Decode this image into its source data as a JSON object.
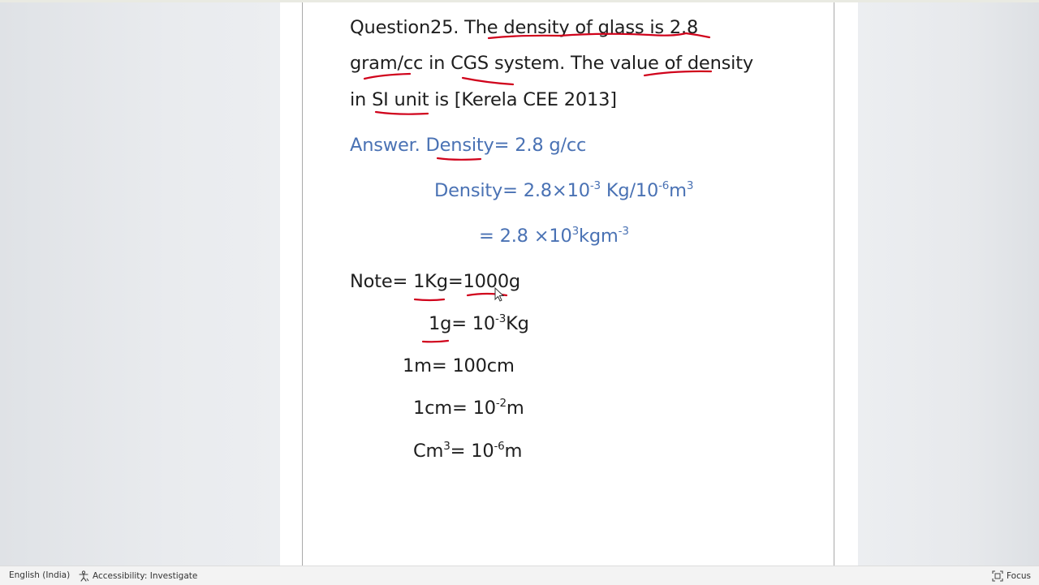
{
  "document": {
    "question": {
      "line1": "Question25. The density of glass is 2.8",
      "line2": "gram/cc in CGS system. The value of density",
      "line3": "in SI unit is [Kerela CEE 2013]"
    },
    "answer": {
      "line1": "Answer. Density= 2.8 g/cc",
      "line2": {
        "base1": "Density= 2.8×10",
        "exp1": "-3",
        "base2": " Kg/10",
        "exp2": "-6",
        "base3": "m",
        "exp3": "3"
      },
      "line3": {
        "base1": "= 2.8 ×10",
        "exp1": "3",
        "base2": "kgm",
        "exp2": "-3"
      }
    },
    "note": {
      "line1": "Note= 1Kg=1000g",
      "line2": {
        "base1": "1g= 10",
        "exp1": "-3",
        "base2": "Kg"
      },
      "line3": "1m= 100cm",
      "line4": {
        "base1": "1cm= 10",
        "exp1": "-2",
        "base2": "m"
      },
      "line5": {
        "base1": "Cm",
        "exp1": "3",
        "base2": "= 10",
        "exp2": "-6",
        "base3": "m"
      }
    }
  },
  "statusbar": {
    "language": "English (India)",
    "accessibility": "Accessibility: Investigate",
    "focus": "Focus"
  },
  "colors": {
    "text": "#1e1e1e",
    "answer_blue": "#4a72b4",
    "ink_red": "#d0021b"
  },
  "icons": {
    "accessibility": "accessibility-icon",
    "focus": "focus-icon",
    "cursor": "mouse-cursor-icon"
  }
}
